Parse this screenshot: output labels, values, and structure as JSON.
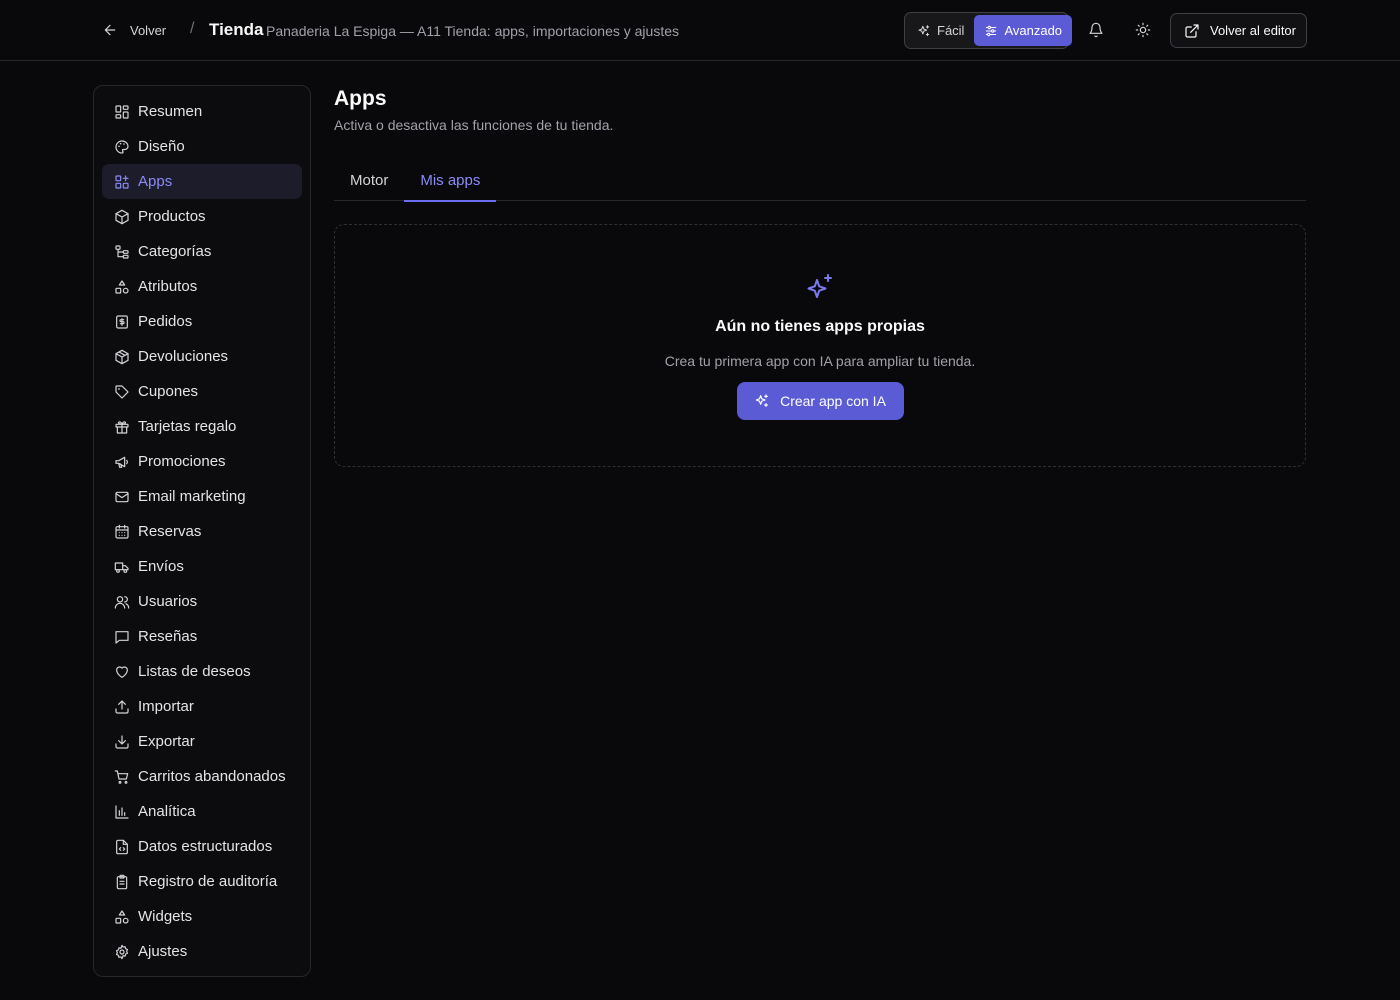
{
  "header": {
    "back_label": "Volver",
    "separator": "/",
    "title": "Tienda",
    "subtitle": "Panaderia La Espiga — A11 Tienda: apps, importaciones y ajustes",
    "mode_easy": "Fácil",
    "mode_advanced": "Avanzado",
    "active_mode": "Avanzado",
    "editor_label": "Volver al editor"
  },
  "sidebar": {
    "active": "Apps",
    "items": [
      {
        "label": "Resumen",
        "icon": "dashboard-icon"
      },
      {
        "label": "Diseño",
        "icon": "palette-icon"
      },
      {
        "label": "Apps",
        "icon": "apps-icon"
      },
      {
        "label": "Productos",
        "icon": "package-icon"
      },
      {
        "label": "Categorías",
        "icon": "tree-icon"
      },
      {
        "label": "Atributos",
        "icon": "shapes-icon"
      },
      {
        "label": "Pedidos",
        "icon": "receipt-icon"
      },
      {
        "label": "Devoluciones",
        "icon": "package-return-icon"
      },
      {
        "label": "Cupones",
        "icon": "tag-icon"
      },
      {
        "label": "Tarjetas regalo",
        "icon": "gift-icon"
      },
      {
        "label": "Promociones",
        "icon": "megaphone-icon"
      },
      {
        "label": "Email marketing",
        "icon": "mail-icon"
      },
      {
        "label": "Reservas",
        "icon": "calendar-icon"
      },
      {
        "label": "Envíos",
        "icon": "truck-icon"
      },
      {
        "label": "Usuarios",
        "icon": "users-icon"
      },
      {
        "label": "Reseñas",
        "icon": "message-icon"
      },
      {
        "label": "Listas de deseos",
        "icon": "heart-icon"
      },
      {
        "label": "Importar",
        "icon": "upload-icon"
      },
      {
        "label": "Exportar",
        "icon": "download-icon"
      },
      {
        "label": "Carritos abandonados",
        "icon": "cart-icon"
      },
      {
        "label": "Analítica",
        "icon": "bar-chart-icon"
      },
      {
        "label": "Datos estructurados",
        "icon": "file-code-icon"
      },
      {
        "label": "Registro de auditoría",
        "icon": "clipboard-icon"
      },
      {
        "label": "Widgets",
        "icon": "shapes-icon"
      },
      {
        "label": "Ajustes",
        "icon": "gear-icon"
      }
    ]
  },
  "main": {
    "title": "Apps",
    "description": "Activa o desactiva las funciones de tu tienda.",
    "tabs": [
      {
        "label": "Motor",
        "active": false
      },
      {
        "label": "Mis apps",
        "active": true
      }
    ],
    "empty": {
      "title": "Aún no tienes apps propias",
      "description": "Crea tu primera app con IA para ampliar tu tienda.",
      "button_label": "Crear app con IA"
    }
  },
  "colors": {
    "background": "#09090b",
    "accent": "#5b5bd6",
    "accent_text": "#8b8bf5",
    "border": "#27272a"
  }
}
